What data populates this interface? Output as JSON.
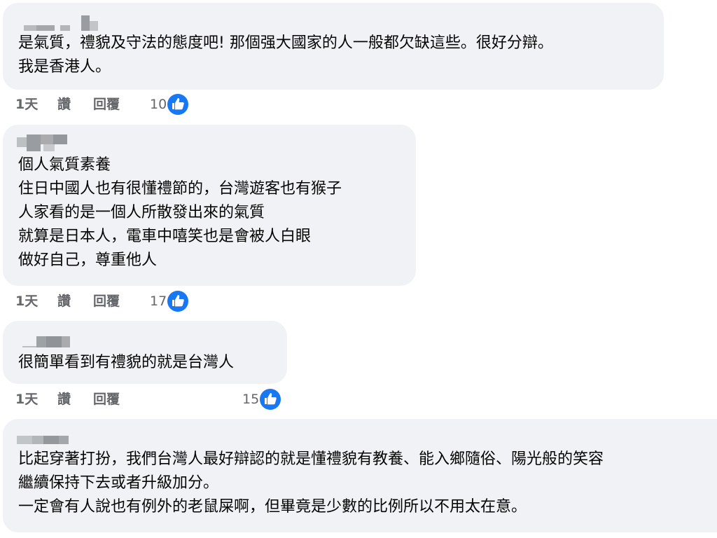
{
  "colors": {
    "bubble": "#f0f2f5",
    "text": "#050505",
    "meta": "#65676b",
    "like_badge": "#1877f2",
    "redacted_name": "#8a8d91"
  },
  "comments": [
    {
      "author_redacted": true,
      "lines": [
        "是氣質，禮貌及守法的態度吧! 那個强大國家的人一般都欠缺這些。很好分辯。",
        "我是香港人。"
      ],
      "time": "1天",
      "like_label": "讚",
      "reply_label": "回覆",
      "reaction_count": "10",
      "reaction_icon": "thumbs-up-icon"
    },
    {
      "author_redacted": true,
      "lines": [
        "個人氣質素養",
        "住日中國人也有很懂禮節的，台灣遊客也有猴子",
        "人家看的是一個人所散發出來的氣質",
        "就算是日本人，電車中嘻笑也是會被人白眼",
        "做好自己，尊重他人"
      ],
      "time": "1天",
      "like_label": "讚",
      "reply_label": "回覆",
      "reaction_count": "17",
      "reaction_icon": "thumbs-up-icon"
    },
    {
      "author_redacted": true,
      "lines": [
        "很簡單看到有禮貌的就是台灣人"
      ],
      "time": "1天",
      "like_label": "讚",
      "reply_label": "回覆",
      "reaction_count": "15",
      "reaction_icon": "thumbs-up-icon"
    },
    {
      "author_redacted": true,
      "lines": [
        "比起穿著打扮，我們台灣人最好辯認的就是懂禮貌有教養、能入鄉隨俗、陽光般的笑容",
        "繼續保持下去或者升級加分。",
        "一定會有人說也有例外的老鼠屎啊，但畢竟是少數的比例所以不用太在意。"
      ]
    }
  ]
}
